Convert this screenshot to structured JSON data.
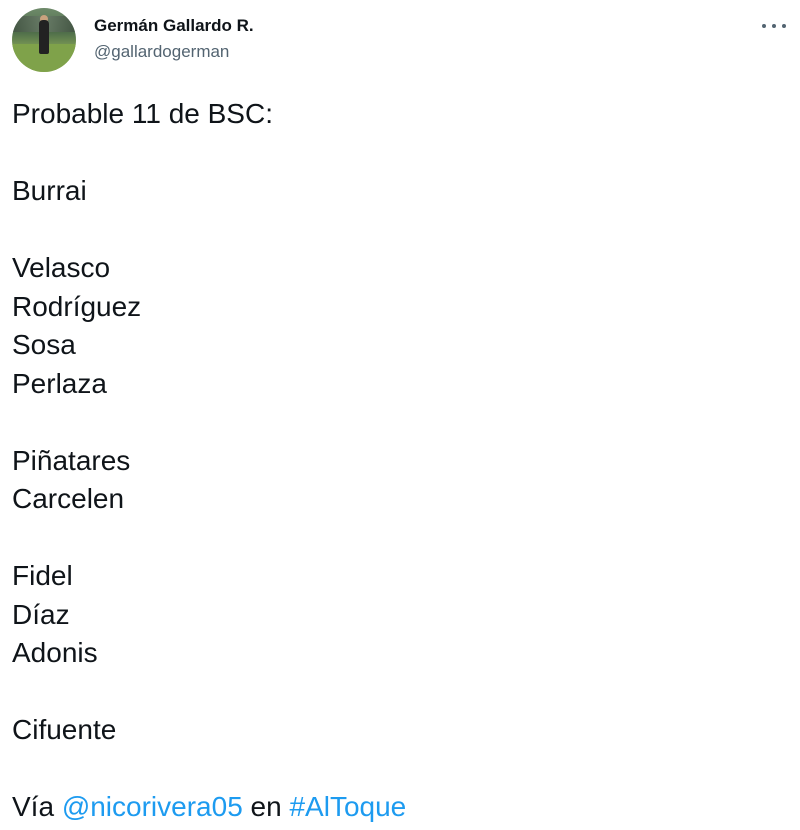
{
  "author": {
    "name": "Germán Gallardo R.",
    "handle": "@gallardogerman"
  },
  "tweet": {
    "title": "Probable 11 de BSC:",
    "goalkeeper": "Burrai",
    "defenders": [
      "Velasco",
      "Rodríguez",
      "Sosa",
      "Perlaza"
    ],
    "midfielders": [
      "Piñatares",
      "Carcelen"
    ],
    "attacking": [
      "Fidel",
      "Díaz",
      "Adonis"
    ],
    "forward": "Cifuente",
    "via_prefix": "Vía",
    "mention": "@nicorivera05",
    "connector": "en",
    "hashtag": "#AlToque"
  },
  "icons": {
    "more": "more-horizontal-icon",
    "avatar": "profile-photo"
  },
  "colors": {
    "link": "#1d9bf0",
    "text": "#0f1419",
    "muted": "#536471"
  }
}
